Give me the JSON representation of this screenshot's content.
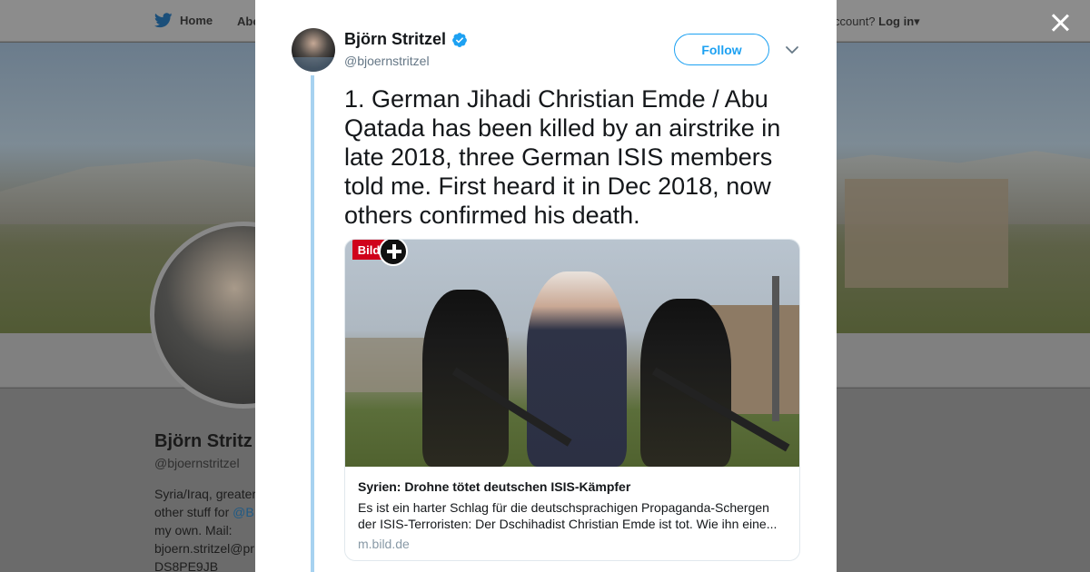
{
  "background": {
    "nav": {
      "home_label": "Home",
      "about_label": "Abo",
      "login_prefix": "ccount?",
      "login_label": "Log in"
    },
    "profile": {
      "name": "Björn Stritz",
      "handle": "@bjoernstritzel",
      "bio_line1": "Syria/Iraq, greater",
      "bio_line2_prefix": "other stuff for",
      "bio_line2_link": "@B",
      "bio_line3": "my own. Mail:",
      "bio_line4": "bjoern.stritzel@pr",
      "bio_line5": "DS8PE9JB"
    }
  },
  "tweet": {
    "author_name": "Björn Stritzel",
    "author_handle": "@bjoernstritzel",
    "follow_label": "Follow",
    "text": "1. German Jihadi Christian Emde / Abu Qatada has been killed by an airstrike in late 2018, three German ISIS members told me. First heard it in Dec 2018, now others confirmed his death.",
    "card": {
      "logo_text": "Bild",
      "title": "Syrien: Drohne tötet deutschen ISIS-Kämpfer",
      "description": "Es ist ein harter Schlag für die deutschsprachigen Propaganda-Schergen der ISIS-Terroristen: Der Dschihadist Christian Emde ist tot. Wie ihn eine...",
      "domain": "m.bild.de"
    }
  },
  "colors": {
    "accent": "#1da1f2",
    "thread_line": "#a7d2f0",
    "verified": "#1da1f2"
  },
  "icons": {
    "bird": "twitter-bird-icon",
    "verified": "verified-badge-icon",
    "caret": "chevron-down-icon",
    "close": "close-icon"
  }
}
